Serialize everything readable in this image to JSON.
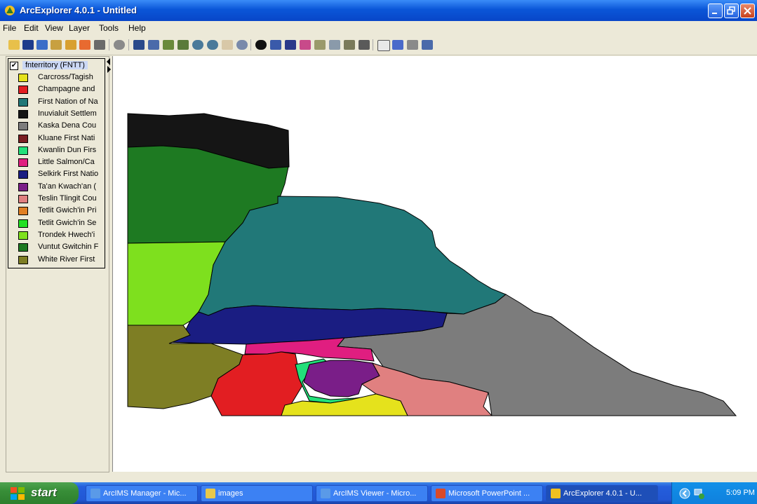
{
  "window": {
    "title": "ArcExplorer 4.0.1 - Untitled"
  },
  "menu": [
    "File",
    "Edit",
    "View",
    "Layer",
    "Tools",
    "Help"
  ],
  "toolbar": {
    "icons": [
      "open-icon",
      "save-icon",
      "add-data-icon",
      "open-folder-icon",
      "properties-icon",
      "theme-icon",
      "print-icon",
      "identify-disc-icon",
      "back-extent-icon",
      "forward-extent-icon",
      "zoom-layer-icon",
      "zoom-full-icon",
      "zoom-in-icon",
      "zoom-out-icon",
      "pan-icon",
      "refresh-icon",
      "info-icon",
      "select-icon",
      "find-icon",
      "query-icon",
      "measure-icon",
      "buffer-icon",
      "hyperlink-icon",
      "export-icon",
      "eraser-icon",
      "map-tips-icon",
      "grid-icon",
      "table-icon"
    ]
  },
  "legend": {
    "layer_name": "fnterritory (FNTT)",
    "checked": "✔",
    "items": [
      {
        "label": "Carcross/Tagish",
        "color": "#E5E21C"
      },
      {
        "label": "Champagne and",
        "color": "#E21E22"
      },
      {
        "label": "First Nation of Na",
        "color": "#217878"
      },
      {
        "label": "Inuvialuit Settlem",
        "color": "#151515"
      },
      {
        "label": "Kaska Dena Cou",
        "color": "#7C7C7C"
      },
      {
        "label": "Kluane First Nati",
        "color": "#7A1E22"
      },
      {
        "label": "Kwanlin Dun Firs",
        "color": "#22E07A"
      },
      {
        "label": "Little Salmon/Ca",
        "color": "#E01E80"
      },
      {
        "label": "Selkirk First Natio",
        "color": "#1A1D82"
      },
      {
        "label": "Ta'an Kwach'an (",
        "color": "#7A1E88"
      },
      {
        "label": "Teslin Tlingit Cou",
        "color": "#E08080"
      },
      {
        "label": "Tetlit Gwich'in Pri",
        "color": "#E07F24"
      },
      {
        "label": "Tetlit Gwich'in Se",
        "color": "#22E022"
      },
      {
        "label": "Trondek Hwech'i",
        "color": "#7EE01E"
      },
      {
        "label": "Vuntut Gwitchin F",
        "color": "#1E7A22"
      },
      {
        "label": "White River First",
        "color": "#7E7E24"
      }
    ]
  },
  "taskbar": {
    "start": "start",
    "buttons": [
      {
        "label": "ArcIMS Manager - Mic...",
        "icon": "ie-icon",
        "active": false
      },
      {
        "label": "images",
        "icon": "folder-icon",
        "active": false
      },
      {
        "label": "ArcIMS Viewer - Micro...",
        "icon": "ie-icon",
        "active": false
      },
      {
        "label": "Microsoft PowerPoint ...",
        "icon": "powerpoint-icon",
        "active": false
      },
      {
        "label": "ArcExplorer 4.0.1 - U...",
        "icon": "arcexplorer-icon",
        "active": true
      }
    ],
    "clock": "5:09 PM"
  }
}
